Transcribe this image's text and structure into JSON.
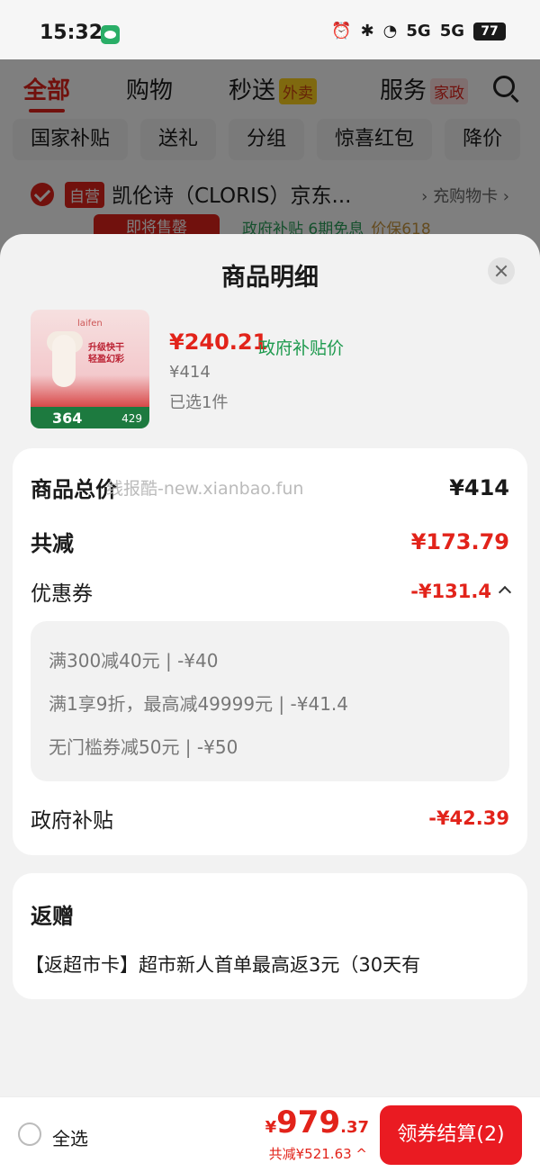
{
  "status_bar": {
    "time": "15:32",
    "net1": "5G",
    "net2": "5G",
    "battery": "77"
  },
  "category_tabs": [
    "全部",
    "购物",
    "秒送",
    "服务"
  ],
  "category_tags": {
    "miaosong": "外卖",
    "fuwu": "家政"
  },
  "chips": [
    "国家补贴",
    "送礼",
    "分组",
    "惊喜红包",
    "降价"
  ],
  "store": {
    "tag": "自营",
    "name": "凯伦诗（CLORIS）京东...",
    "link": "› 充购物卡 ›",
    "sale_soon": "即将售罄",
    "promo": "政府补贴   6期免息",
    "price_guard": "价保618"
  },
  "sheet": {
    "title": "商品明细",
    "product": {
      "brand": "laifen",
      "thumb_text": "升级快干 轻盈幻彩",
      "thumb_price": "364",
      "thumb_price2": "429",
      "price": "¥240.21",
      "price_label": "政府补贴价",
      "original_price": "¥414",
      "selected": "已选1件"
    },
    "summary": {
      "total_label": "商品总价",
      "total_value": "¥414",
      "watermark": "线报酷-new.xianbao.fun",
      "reduce_label": "共减",
      "reduce_value": "¥173.79",
      "coupon_label": "优惠券",
      "coupon_value": "-¥131.4",
      "coupons": [
        "满300减40元 | -¥40",
        "满1享9折，最高减49999元 | -¥41.4",
        "无门槛券减50元 | -¥50"
      ],
      "gov_label": "政府补贴",
      "gov_value": "-¥42.39"
    },
    "gift": {
      "title": "返赠",
      "text": "【返超市卡】超市新人首单最高返3元（30天有"
    }
  },
  "bottom": {
    "select_all": "全选",
    "currency": "¥",
    "total_int": "979",
    "total_dec": ".37",
    "saving": "共减¥521.63 ^",
    "checkout": "领券结算(2)"
  },
  "colors": {
    "accent": "#e2231a",
    "green": "#1e9a4e",
    "checkout_bg": "#ea1b22"
  }
}
